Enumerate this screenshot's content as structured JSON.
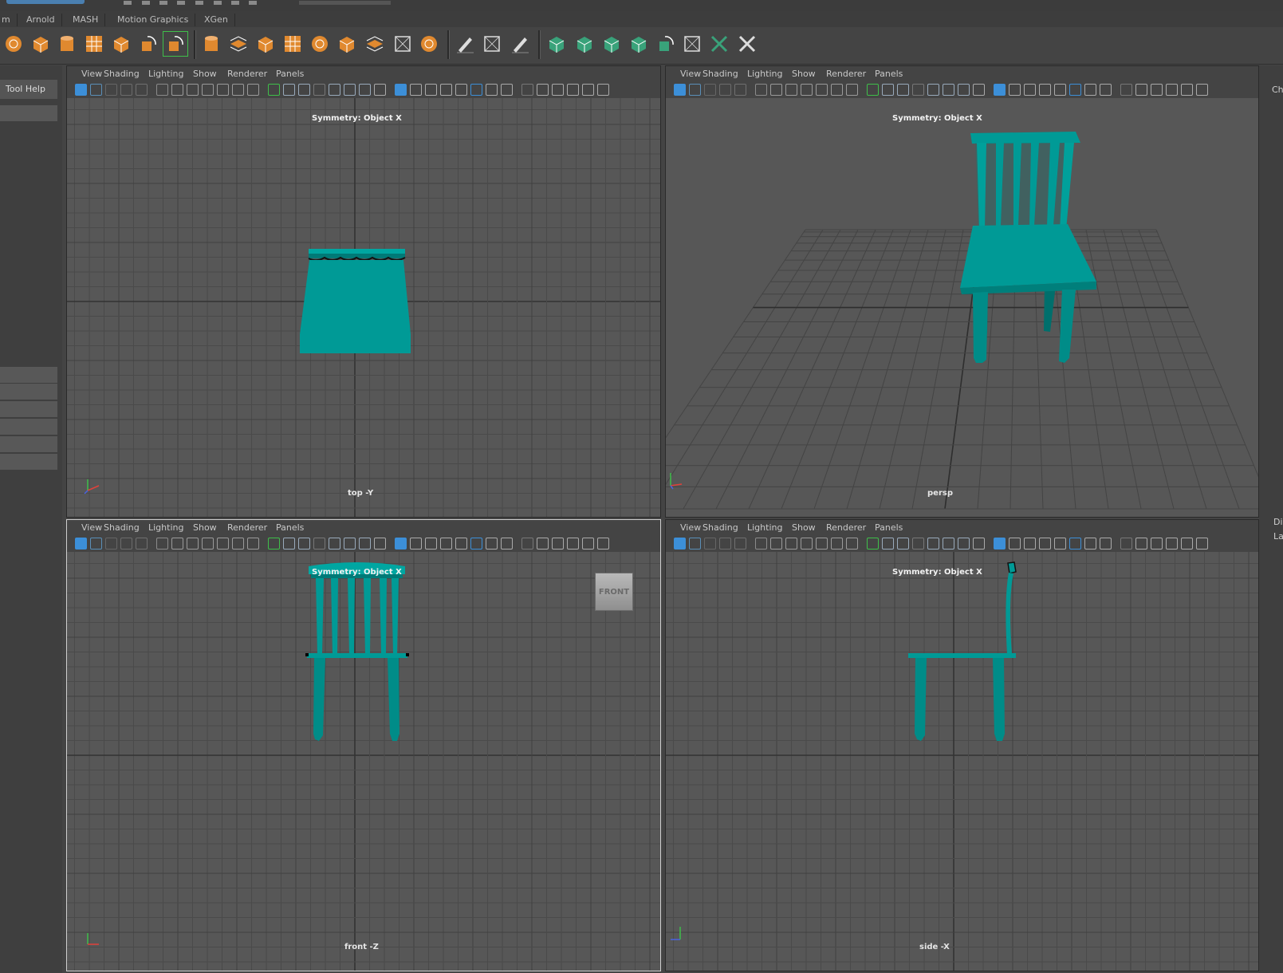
{
  "shelf_tabs": [
    "m",
    "Arnold",
    "MASH",
    "Motion Graphics",
    "XGen"
  ],
  "left_panel": {
    "tool_help_label": "Tool Help"
  },
  "viewport_menu": [
    "View",
    "Shading",
    "Lighting",
    "Show",
    "Renderer",
    "Panels"
  ],
  "viewports": {
    "top": {
      "camera": "top -Y",
      "symmetry": "Symmetry: Object X"
    },
    "persp": {
      "camera": "persp",
      "symmetry": "Symmetry: Object X"
    },
    "front": {
      "camera": "front -Z",
      "symmetry": "Symmetry: Object X",
      "view_cube_label": "FRONT"
    },
    "side": {
      "camera": "side -X",
      "symmetry": "Symmetry: Object X"
    }
  },
  "right_strip": {
    "label_top": "Ch",
    "label_mid": "Di",
    "label_mid2": "La"
  },
  "colors": {
    "model": "#009a96",
    "model_dark": "#006f6c",
    "grid": "#4a4a4a",
    "grid_axis": "#333333",
    "viewport_bg": "#575757",
    "shelf_orange": "#e0892f",
    "shelf_green": "#39a27a",
    "highlight_green": "#3fbf4a"
  },
  "icons": [
    "shelf-polygon-icons",
    "shelf-modeling-tools-icons",
    "axis-gizmo-icon"
  ]
}
